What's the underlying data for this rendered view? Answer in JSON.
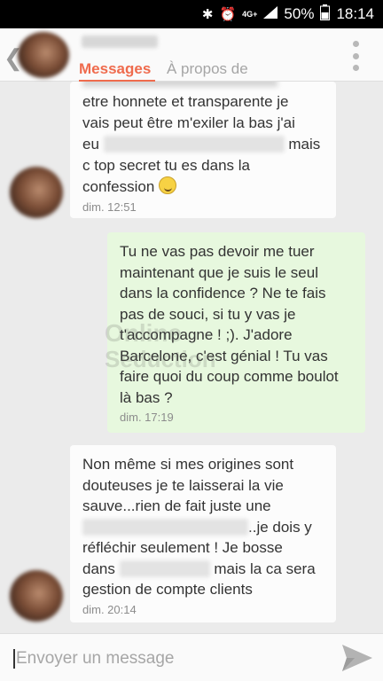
{
  "status_bar": {
    "battery_percent": "50%",
    "time": "18:14",
    "network": "4G+",
    "icons": [
      "bluetooth-icon",
      "alarm-icon",
      "signal-icon",
      "battery-icon"
    ]
  },
  "header": {
    "tabs": [
      {
        "label": "Messages",
        "active": true
      },
      {
        "label": "À propos de",
        "active": false
      }
    ],
    "accent_color": "#ef6b4d"
  },
  "messages": [
    {
      "direction": "in",
      "lines": [
        "etre honnete et transparente je",
        "vais peut être m'exiler la bas j'ai"
      ],
      "line3_start": "eu",
      "line3_end": "mais",
      "line4": "c top secret tu es dans la",
      "line5": "confession",
      "meta": "dim. 12:51"
    },
    {
      "direction": "out",
      "text": "Tu ne vas pas devoir me tuer maintenant que je suis le seul dans la confidence ? Ne te fais pas de souci, si tu y vas je t'accompagne ! ;). J'adore Barcelone, c'est génial ! Tu vas faire quoi du coup comme boulot là bas ?",
      "meta": "dim. 17:19"
    },
    {
      "direction": "in",
      "line1": "Non même si mes origines sont",
      "line2": "douteuses je te laisserai la vie",
      "line3": "sauve...rien de fait juste une",
      "line4_end": "..je dois y",
      "line5": "réfléchir seulement ! Je bosse",
      "line6_start": "dans",
      "line6_end": "mais la ca sera",
      "line7": "gestion de compte clients",
      "meta": "dim. 20:14"
    }
  ],
  "watermark": {
    "line1": "Online",
    "line2": "Seduction"
  },
  "composer": {
    "placeholder": "Envoyer un message"
  }
}
